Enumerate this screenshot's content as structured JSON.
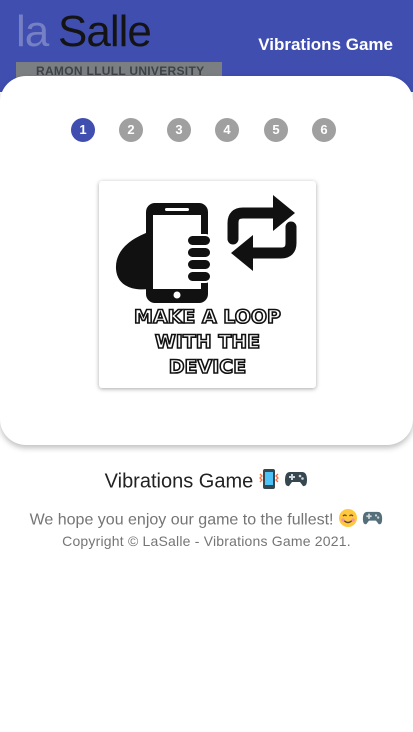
{
  "header": {
    "logo_la": "la",
    "logo_salle": "Salle",
    "logo_university": "RAMON LLULL UNIVERSITY",
    "app_title": "Vibrations Game",
    "colors": {
      "primary": "#3f4eaf",
      "step_inactive": "#a0a0a0"
    }
  },
  "steps": [
    {
      "label": "1",
      "active": true
    },
    {
      "label": "2",
      "active": false
    },
    {
      "label": "3",
      "active": false
    },
    {
      "label": "4",
      "active": false
    },
    {
      "label": "5",
      "active": false
    },
    {
      "label": "6",
      "active": false
    }
  ],
  "instruction": {
    "line1": "MAKE A LOOP",
    "line2": "WITH THE",
    "line3": "DEVICE",
    "icons": [
      "hand-holding-phone-icon",
      "loop-arrows-icon"
    ]
  },
  "footer": {
    "title": "Vibrations Game",
    "title_icons": [
      "vibrating-phone-icon",
      "gamepad-icon"
    ],
    "message": "We hope you enjoy our game to the fullest!",
    "message_icons": [
      "smiling-face-icon",
      "gamepad-icon"
    ],
    "copyright": "Copyright © LaSalle - Vibrations Game 2021."
  }
}
